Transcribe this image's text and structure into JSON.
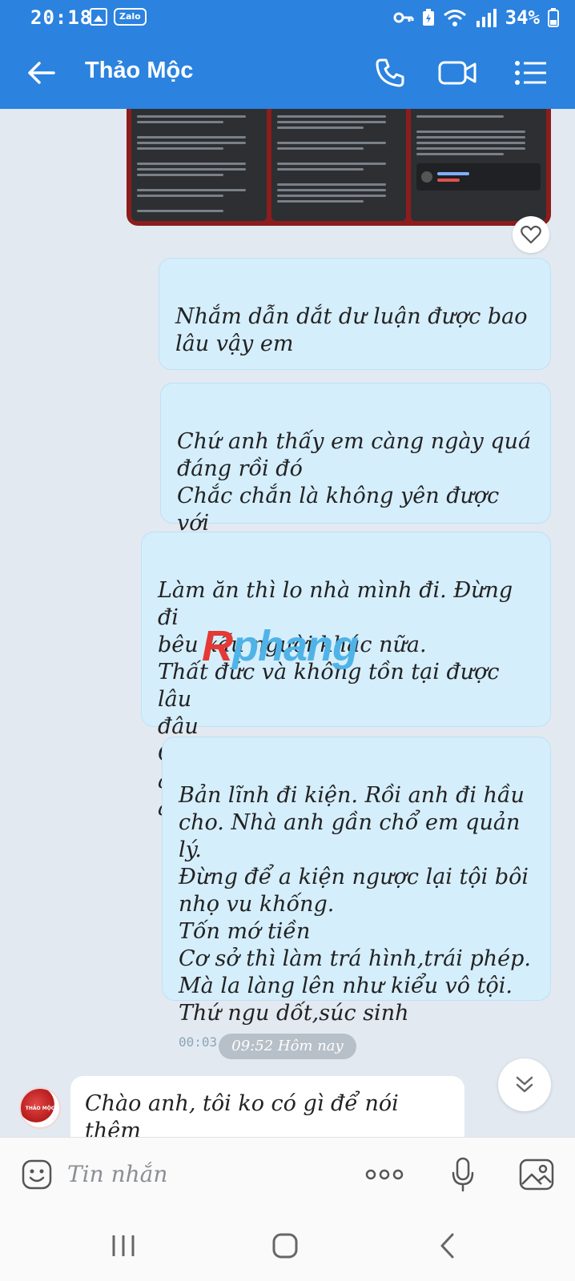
{
  "status_bar": {
    "time": "20:18",
    "app_badge": "Zalo",
    "battery": "34%"
  },
  "header": {
    "title": "Thảo Mộc"
  },
  "messages": [
    {
      "text": "Nhắm dẫn dắt dư luận được bao\nlâu vậy em"
    },
    {
      "text": "Chứ anh thấy em càng ngày quá\nđáng rồi đó\nChắc chắn là không yên được với\ntôi trong chuyện này nhé"
    },
    {
      "text": "Làm ăn thì lo nhà mình đi. Đừng đi\nbêu xấu người khác nữa.\nThất đức và không tồn tại được lâu\nđâu\nCái chổ này mà không dẹp sớm anh\năn cứt của em."
    },
    {
      "text": "Bản lĩnh đi kiện. Rồi anh đi hầu\ncho. Nhà anh gần chổ em quản lý.\nĐừng để a kiện ngược lại tội bôi\nnhọ vu khống.\nTốn mớ tiền\nCơ sở thì làm trá hình,trái phép.\nMà la làng lên như kiểu vô tội.\nThứ ngu dốt,súc sinh",
      "time": "00:03"
    }
  ],
  "date_divider": "09:52 Hôm nay",
  "incoming": {
    "text": "Chào anh, tôi ko có gì để nói thêm"
  },
  "watermark": {
    "part1": "R",
    "part2": "phang"
  },
  "input": {
    "placeholder": "Tin nhắn"
  },
  "colors": {
    "accent": "#2b82df",
    "bubble": "#d5eefc",
    "background": "#e2e9f1"
  }
}
